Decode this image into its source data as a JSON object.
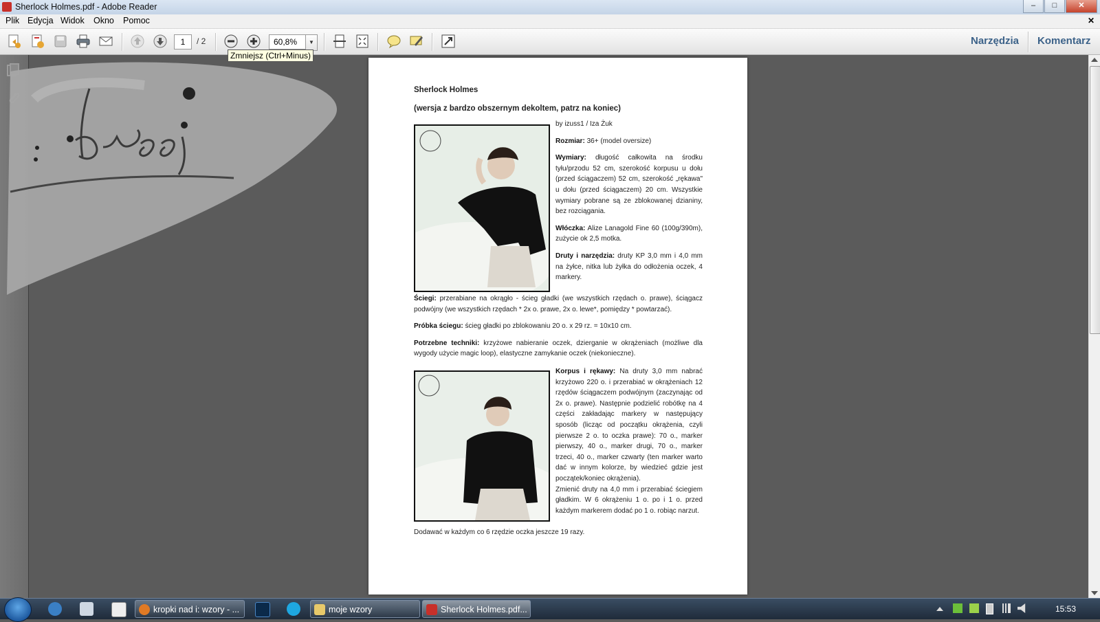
{
  "window": {
    "title": "Sherlock Holmes.pdf - Adobe Reader",
    "controls": {
      "minimize": "–",
      "maximize": "□",
      "close": "✕"
    }
  },
  "menu": {
    "items": [
      "Plik",
      "Edycja",
      "Widok",
      "Okno",
      "Pomoc"
    ],
    "close_doc": "✕"
  },
  "toolbar": {
    "page_current": "1",
    "page_total": "/ 2",
    "zoom": "60,8%",
    "tools_label": "Narzędzia",
    "comment_label": "Komentarz",
    "tooltip": "Zmniejsz (Ctrl+Minus)"
  },
  "document": {
    "title": "Sherlock Holmes",
    "subtitle": "(wersja z bardzo obszernym dekoltem, patrz na koniec)",
    "author": "by izuss1 / Iza Żuk",
    "size_label": "Rozmiar:",
    "size_text": " 36+ (model oversize)",
    "dim_label": "Wymiary:",
    "dim_text": " długość całkowita na środku tyłu/przodu 52 cm, szerokość korpusu u dołu (przed ściągaczem) 52 cm, szerokość „rękawa\" u dołu (przed ściągaczem) 20 cm. Wszystkie wymiary pobrane są ze zblokowanej dzianiny, bez rozciągania.",
    "yarn_label": "Włóczka:",
    "yarn_text": " Alize Lanagold Fine 60 (100g/390m), zużycie ok 2,5 motka.",
    "needles_label": "Druty i narzędzia:",
    "needles_text": " druty KP 3,0 mm i 4,0 mm na żyłce, nitka lub żyłka do odłożenia oczek, 4 markery.",
    "stitches_label": "Ściegi:",
    "stitches_text": " przerabiane na okrągło - ścieg gładki (we wszystkich rzędach o. prawe), ściągacz podwójny (we wszystkich rzędach * 2x o. prawe, 2x o. lewe*, pomiędzy * powtarzać).",
    "gauge_label": "Próbka ściegu:",
    "gauge_text": " ścieg gładki po zblokowaniu 20 o. x 29 rz. = 10x10 cm.",
    "tech_label": "Potrzebne techniki:",
    "tech_text": " krzyżowe nabieranie oczek, dzierganie w okrążeniach (możliwe dla wygody użycie magic loop), elastyczne zamykanie oczek (niekonieczne).",
    "body_label": "Korpus i rękawy:",
    "body_text": " Na druty 3,0 mm nabrać krzyżowo 220 o. i przerabiać w okrążeniach 12 rzędów ściągaczem podwójnym (zaczynając od 2x o. prawe). Następnie podzielić robótkę na 4 części zakładając markery w następujący sposób (licząc od początku okrążenia, czyli pierwsze 2 o. to oczka prawe): 70 o., marker pierwszy, 40 o., marker drugi, 70 o., marker trzeci, 40 o., marker czwarty (ten marker warto dać w innym kolorze, by wiedzieć gdzie jest początek/koniec okrążenia).",
    "body_text2": "Zmienić druty na 4,0 mm i przerabiać ściegiem gładkim. W 6 okrążeniu 1 o. po i 1 o. przed każdym markerem dodać po 1 o. robiąc narzut.",
    "last_line": "Dodawać w każdym co 6 rzędzie oczka jeszcze 19 razy."
  },
  "taskbar": {
    "tasks": [
      "kropki nad i: wzory - ...",
      "moje wzory",
      "Sherlock Holmes.pdf..."
    ],
    "clock": "15:53"
  },
  "colors": {
    "link_blue": "#3c6289",
    "viewer_bg": "#5b5b5b",
    "taskbar": "#24344a"
  }
}
